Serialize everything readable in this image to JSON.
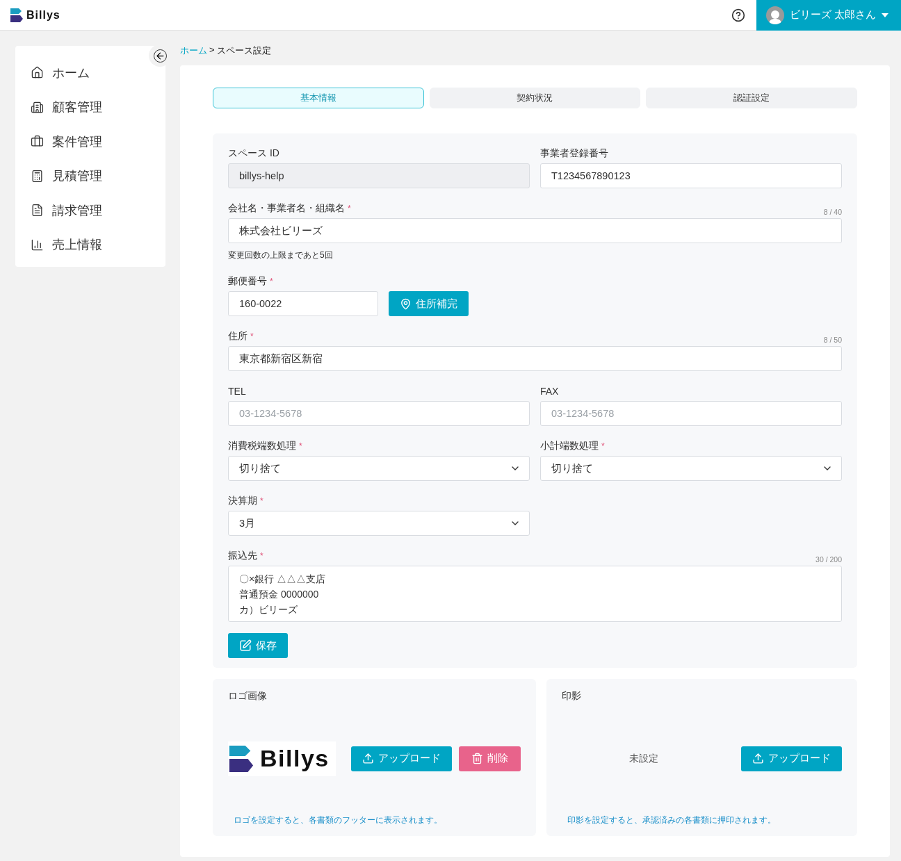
{
  "header": {
    "brand": "Billys",
    "user": {
      "name": "ビリーズ 太郎さん"
    }
  },
  "sidebar": {
    "items": [
      {
        "label": "ホーム",
        "selected": false
      },
      {
        "label": "顧客管理",
        "selected": false
      },
      {
        "label": "案件管理",
        "selected": false
      },
      {
        "label": "見積管理",
        "selected": false
      },
      {
        "label": "請求管理",
        "selected": false
      },
      {
        "label": "売上情報",
        "selected": false
      }
    ]
  },
  "breadcrumb": [
    {
      "label": "ホーム"
    },
    {
      "label": "スペース設定"
    }
  ],
  "breadcrumb_separator": ">",
  "tabs": [
    {
      "label": "基本情報",
      "selected": true
    },
    {
      "label": "契約状況",
      "selected": false
    },
    {
      "label": "認証設定",
      "selected": false
    }
  ],
  "form": {
    "rows": [
      [
        {
          "kind": "text",
          "label": "スペース ID",
          "value": "billys-help",
          "disabled": true
        },
        {
          "kind": "text",
          "label": "事業者登録番号",
          "value": "T1234567890123",
          "disabled": false
        }
      ],
      [
        {
          "kind": "text",
          "label": "会社名・事業者名・組織名",
          "required_mark": "*",
          "counter": "8 / 40",
          "value": "株式会社ビリーズ",
          "disabled": false,
          "note": "変更回数の上限まであと5回"
        }
      ],
      [
        {
          "kind": "postal",
          "label": "郵便番号",
          "required_mark": "*",
          "value": "160-0022",
          "disabled": false,
          "button": "住所補完"
        }
      ],
      [
        {
          "kind": "text",
          "label": "住所",
          "required_mark": "*",
          "counter": "8 / 50",
          "value": "東京都新宿区新宿",
          "disabled": false
        }
      ],
      [
        {
          "kind": "text",
          "label": "TEL",
          "placeholder": "03-1234-5678",
          "disabled": false
        },
        {
          "kind": "text",
          "label": "FAX",
          "placeholder": "03-1234-5678",
          "disabled": false
        }
      ],
      [
        {
          "kind": "select",
          "label": "消費税端数処理",
          "required_mark": "*",
          "value": "切り捨て"
        },
        {
          "kind": "select",
          "label": "小計端数処理",
          "required_mark": "*",
          "value": "切り捨て"
        }
      ],
      [
        {
          "kind": "select",
          "label": "決算期",
          "required_mark": "*",
          "value": "3月"
        }
      ],
      [
        {
          "kind": "textarea",
          "label": "振込先",
          "required_mark": "*",
          "counter": "30 / 200",
          "lines": [
            "〇×銀行 △△△支店",
            "普通預金 0000000",
            "カ）ビリーズ"
          ]
        }
      ]
    ],
    "save_button": "保存"
  },
  "logo_panel": {
    "title": "ロゴ画像",
    "logo_text": "Billys",
    "upload_button": "アップロード",
    "delete_button": "削除",
    "hint": "ロゴを設定すると、各書類のフッターに表示されます。"
  },
  "seal_panel": {
    "title": "印影",
    "status": "未設定",
    "upload_button": "アップロード",
    "hint": "印影を設定すると、承認済みの各書類に押印されます。"
  }
}
